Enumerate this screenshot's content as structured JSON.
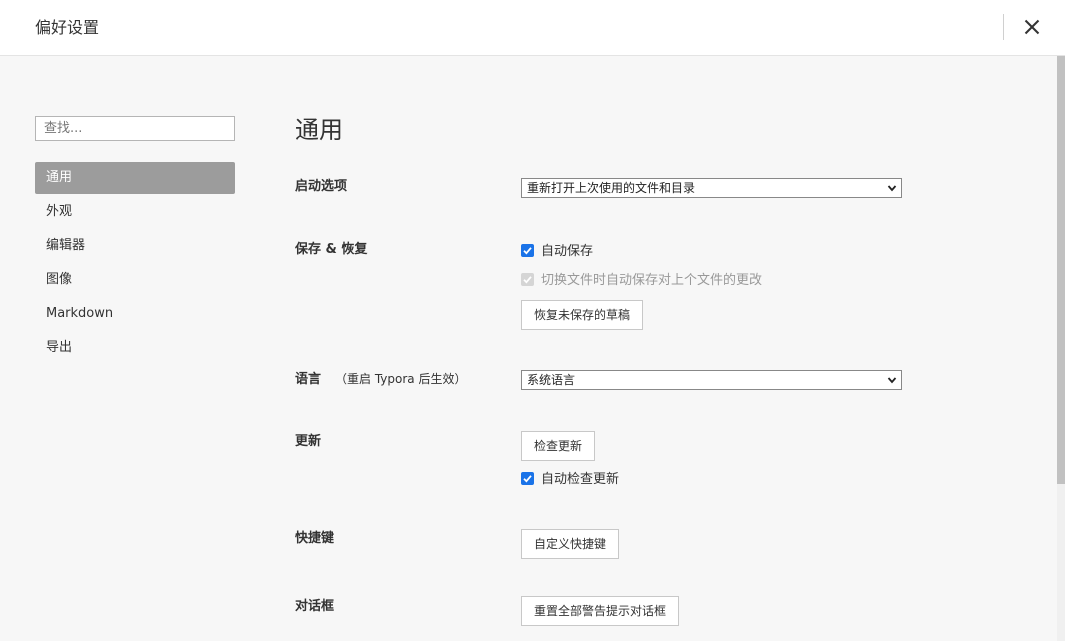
{
  "window": {
    "title": "偏好设置"
  },
  "sidebar": {
    "search": {
      "placeholder": "查找..."
    },
    "items": [
      {
        "label": "通用",
        "active": true
      },
      {
        "label": "外观"
      },
      {
        "label": "编辑器"
      },
      {
        "label": "图像"
      },
      {
        "label": "Markdown"
      },
      {
        "label": "导出"
      }
    ]
  },
  "main": {
    "title": "通用",
    "startup": {
      "label": "启动选项",
      "selected": "重新打开上次使用的文件和目录"
    },
    "save_restore": {
      "label": "保存 & 恢复",
      "autosave": {
        "label": "自动保存",
        "checked": true
      },
      "autosave_on_switch": {
        "label": "切换文件时自动保存对上个文件的更改",
        "checked": true,
        "disabled": true
      },
      "restore_button": "恢复未保存的草稿"
    },
    "language": {
      "label": "语言",
      "hint": "（重启 Typora 后生效）",
      "selected": "系统语言"
    },
    "update": {
      "label": "更新",
      "check_button": "检查更新",
      "auto_check": {
        "label": "自动检查更新",
        "checked": true
      }
    },
    "shortcuts": {
      "label": "快捷键",
      "button": "自定义快捷键"
    },
    "dialogs": {
      "label": "对话框",
      "button": "重置全部警告提示对话框"
    }
  },
  "colors": {
    "accent": "#1a73e8",
    "active_nav_bg": "#9c9c9c",
    "background": "#f7f7f7"
  }
}
